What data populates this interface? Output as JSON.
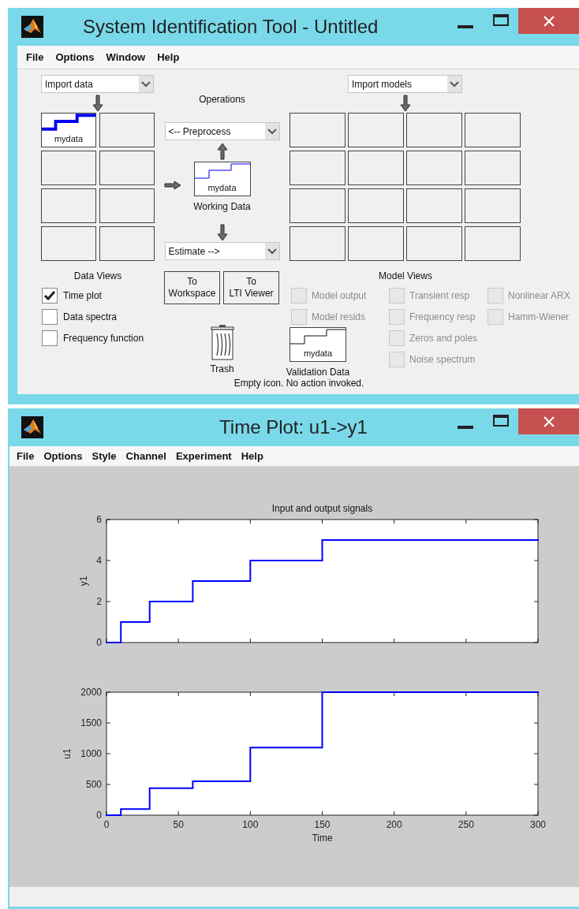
{
  "ident_window": {
    "title": "System Identification Tool - Untitled",
    "menu": [
      "File",
      "Options",
      "Window",
      "Help"
    ],
    "import_data": {
      "value": "Import data"
    },
    "data_board": [
      {
        "kind": "data",
        "label": "mydata",
        "selected": true
      },
      {
        "kind": "empty"
      },
      {
        "kind": "empty"
      },
      {
        "kind": "empty"
      },
      {
        "kind": "empty"
      },
      {
        "kind": "empty"
      },
      {
        "kind": "empty"
      },
      {
        "kind": "empty"
      }
    ],
    "data_views": {
      "label": "Data Views",
      "options": [
        {
          "label": "Time plot",
          "checked": true
        },
        {
          "label": "Data spectra",
          "checked": false
        },
        {
          "label": "Frequency function",
          "checked": false
        }
      ]
    },
    "operations": {
      "label": "Operations",
      "preprocess": {
        "value": "<-- Preprocess"
      },
      "working_data": {
        "label": "mydata",
        "caption": "Working Data"
      },
      "estimate": {
        "value": "Estimate -->"
      },
      "buttons": [
        {
          "lines": [
            "To",
            "Workspace"
          ]
        },
        {
          "lines": [
            "To",
            "LTI Viewer"
          ]
        }
      ],
      "trash": {
        "label": "Trash"
      }
    },
    "import_models": {
      "value": "Import models"
    },
    "model_board": [
      {
        "kind": "empty"
      },
      {
        "kind": "empty"
      },
      {
        "kind": "empty"
      },
      {
        "kind": "empty"
      },
      {
        "kind": "empty"
      },
      {
        "kind": "empty"
      },
      {
        "kind": "empty"
      },
      {
        "kind": "empty"
      },
      {
        "kind": "empty"
      },
      {
        "kind": "empty"
      },
      {
        "kind": "empty"
      },
      {
        "kind": "empty"
      },
      {
        "kind": "empty"
      },
      {
        "kind": "empty"
      },
      {
        "kind": "empty"
      },
      {
        "kind": "empty"
      }
    ],
    "model_views": {
      "label": "Model Views",
      "columns": [
        [
          {
            "label": "Model output",
            "checked": false,
            "disabled": true
          },
          {
            "label": "Model resids",
            "checked": false,
            "disabled": true
          }
        ],
        [
          {
            "label": "Transient resp",
            "checked": false,
            "disabled": true
          },
          {
            "label": "Frequency resp",
            "checked": false,
            "disabled": true
          },
          {
            "label": "Zeros and poles",
            "checked": false,
            "disabled": true
          },
          {
            "label": "Noise spectrum",
            "checked": false,
            "disabled": true
          }
        ],
        [
          {
            "label": "Nonlinear ARX",
            "checked": false,
            "disabled": true
          },
          {
            "label": "Hamm-Wiener",
            "checked": false,
            "disabled": true
          }
        ]
      ]
    },
    "validation": {
      "label": "mydata",
      "caption": "Validation Data",
      "status": "Empty icon. No action invoked."
    }
  },
  "plot_window": {
    "title": "Time Plot: u1->y1",
    "menu": [
      "File",
      "Options",
      "Style",
      "Channel",
      "Experiment",
      "Help"
    ],
    "charts": [
      {
        "chart_data": {
          "type": "line",
          "title": "Input and output signals",
          "ylabel": "y1",
          "x": [
            0,
            10,
            10,
            30,
            30,
            60,
            60,
            100,
            100,
            150,
            150,
            300
          ],
          "series": [
            {
              "color": "#0000ff",
              "values": [
                0,
                0,
                1,
                1,
                2,
                2,
                3,
                3,
                4,
                4,
                5,
                5
              ]
            }
          ],
          "xlim": [
            0,
            300
          ],
          "ylim": [
            0,
            6
          ],
          "yticks": [
            0,
            2,
            4,
            6
          ]
        }
      },
      {
        "chart_data": {
          "type": "line",
          "xlabel": "Time",
          "ylabel": "u1",
          "x": [
            0,
            10,
            10,
            30,
            30,
            60,
            60,
            100,
            100,
            150,
            150,
            300
          ],
          "series": [
            {
              "color": "#0000ff",
              "values": [
                0,
                0,
                100,
                100,
                440,
                440,
                550,
                550,
                1100,
                1100,
                2000,
                2000
              ]
            }
          ],
          "xlim": [
            0,
            300
          ],
          "ylim": [
            0,
            2000
          ],
          "xticks": [
            0,
            50,
            100,
            150,
            200,
            250,
            300
          ],
          "yticks": [
            0,
            500,
            1000,
            1500,
            2000
          ]
        }
      }
    ]
  }
}
